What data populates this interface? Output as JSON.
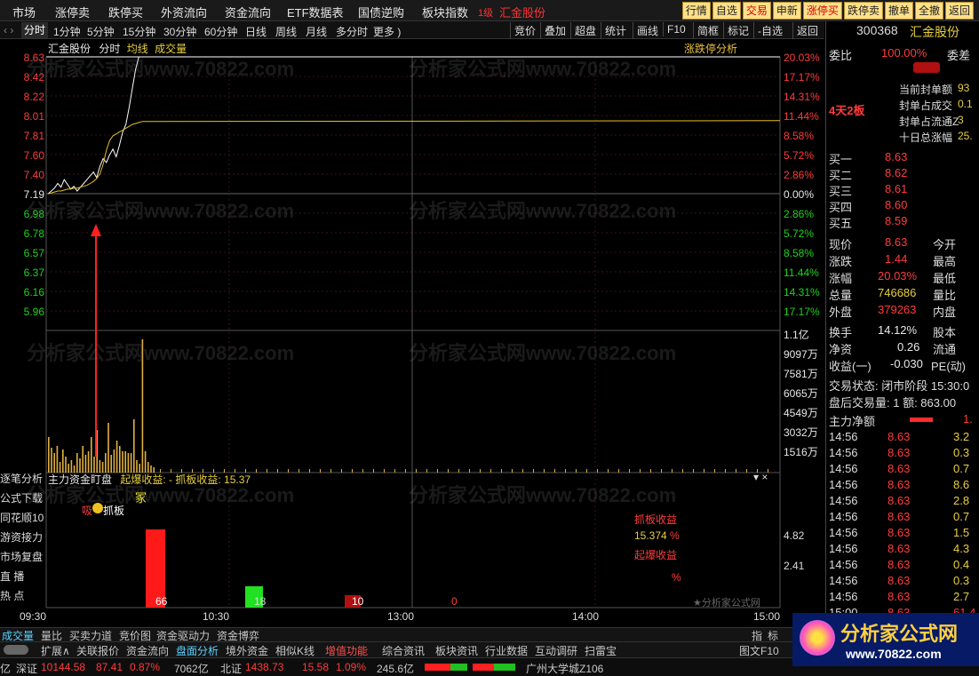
{
  "topbar": {
    "menus": [
      "市场",
      "涨停卖",
      "跌停买",
      "外资流向",
      "资金流向",
      "ETF数据表",
      "国债逆购",
      "板块指数"
    ],
    "stock_badge": "1级",
    "stock_name": "汇金股份",
    "buttons": [
      "行情",
      "自选",
      "交易",
      "申新",
      "涨停买",
      "跌停卖",
      "撤单",
      "全撤",
      "返回"
    ]
  },
  "toolbar": {
    "tabs": [
      "分时",
      "1分钟",
      "5分钟",
      "15分钟",
      "30分钟",
      "60分钟",
      "日线",
      "周线",
      "月线",
      "多分时",
      "更多 )"
    ],
    "right": [
      "竞价",
      "叠加",
      "超盘",
      "统计",
      "画线",
      "简框",
      "标记",
      "-自选",
      "返回"
    ]
  },
  "chart": {
    "title_stock": "汇金股份",
    "title_mode": "分时",
    "title_avg": "均线",
    "title_vol": "成交量",
    "title_right": "涨跌停分析",
    "price_labels": [
      "8.63",
      "8.42",
      "8.22",
      "8.01",
      "7.81",
      "7.60",
      "7.40",
      "7.19",
      "6.98",
      "6.78",
      "6.57",
      "6.37",
      "6.16",
      "5.96"
    ],
    "pct_labels": [
      "20.03%",
      "17.17%",
      "14.31%",
      "11.44%",
      "8.58%",
      "5.72%",
      "2.86%",
      "0.00%",
      "2.86%",
      "5.72%",
      "8.58%",
      "11.44%",
      "14.31%",
      "17.17%"
    ],
    "vol_labels": [
      "1.1亿",
      "9097万",
      "7581万",
      "6065万",
      "4549万",
      "3032万",
      "1516万"
    ]
  },
  "chart_data": {
    "type": "line",
    "x_ticks": [
      "09:30",
      "10:30",
      "13:00",
      "14:00",
      "15:00"
    ],
    "ylim": [
      5.96,
      8.63
    ],
    "series": [],
    "price": [
      7.19,
      7.22,
      7.25,
      7.3,
      7.26,
      7.34,
      7.29,
      7.24,
      7.27,
      7.22,
      7.26,
      7.3,
      7.34,
      7.38,
      7.42,
      7.36,
      7.48,
      7.56,
      7.52,
      7.6,
      7.66,
      7.58,
      7.7,
      7.84,
      7.92,
      8.1,
      8.3,
      8.5,
      8.63,
      8.63
    ],
    "avg": [
      7.19,
      7.2,
      7.21,
      7.22,
      7.22,
      7.23,
      7.24,
      7.24,
      7.25,
      7.25,
      7.26,
      7.27,
      7.28,
      7.3,
      7.32,
      7.35,
      7.4,
      7.5,
      7.65,
      7.75,
      7.8,
      7.82,
      7.84,
      7.86,
      7.88,
      7.9,
      7.92,
      7.93,
      7.94,
      7.95
    ]
  },
  "lower": {
    "title": "主力资金盯盘",
    "sub": "起爆收益: -  抓板收益: 15.37",
    "annot_left": "吸",
    "annot_mid": "抓板",
    "annot_top": "冢",
    "legend1": "抓板收益",
    "legend1_val": "15.374",
    "legend1_unit": "%",
    "legend2": "起爆收益",
    "legend2_unit": "%",
    "axis1": "4.82",
    "axis2": "2.41",
    "bar1_label": "66",
    "bar2_label": "18",
    "bar3_label": "10",
    "bar4_label": "0",
    "watermark": "★分析家公式网"
  },
  "sidenav": [
    "逐笔分析",
    "公式下载",
    "同花顺10",
    "游资接力",
    "市场复盘",
    "直  播",
    "热  点"
  ],
  "rpanel": {
    "code": "300368",
    "name": "汇金股份",
    "webi_label": "委比",
    "webi_val": "100.00%",
    "webi_diff": "委差",
    "days_label": "4天2板",
    "seal_rows": [
      "当前封单额",
      "封单占成交",
      "封单占流通Z",
      "十日总涨幅"
    ],
    "seal_vals": [
      "93",
      "0.1",
      "3",
      "25."
    ],
    "buys": [
      {
        "label": "买一",
        "price": "8.63"
      },
      {
        "label": "买二",
        "price": "8.62"
      },
      {
        "label": "买三",
        "price": "8.61"
      },
      {
        "label": "买四",
        "price": "8.60"
      },
      {
        "label": "买五",
        "price": "8.59"
      }
    ],
    "quote": [
      {
        "label": "现价",
        "val": "8.63",
        "l2": "今开"
      },
      {
        "label": "涨跌",
        "val": "1.44",
        "l2": "最高"
      },
      {
        "label": "涨幅",
        "val": "20.03%",
        "l2": "最低"
      },
      {
        "label": "总量",
        "val": "746686",
        "l2": "量比"
      },
      {
        "label": "外盘",
        "val": "379263",
        "l2": "内盘"
      },
      {
        "label": "换手",
        "val": "14.12%",
        "l2": "股本"
      },
      {
        "label": "净资",
        "val": "0.26",
        "l2": "流通"
      },
      {
        "label": "收益(一)",
        "val": "-0.030",
        "l2": "PE(动)"
      }
    ],
    "trade_state": "交易状态: 闭市阶段 15:30:0",
    "after_trade": "盘后交易量: 1  额: 863.00",
    "flow_label": "主力净额",
    "flow_val": "1.",
    "ticks": [
      {
        "t": "14:56",
        "p": "8.63",
        "v": "3.2"
      },
      {
        "t": "14:56",
        "p": "8.63",
        "v": "0.3"
      },
      {
        "t": "14:56",
        "p": "8.63",
        "v": "0.7"
      },
      {
        "t": "14:56",
        "p": "8.63",
        "v": "8.6"
      },
      {
        "t": "14:56",
        "p": "8.63",
        "v": "2.8"
      },
      {
        "t": "14:56",
        "p": "8.63",
        "v": "0.7"
      },
      {
        "t": "14:56",
        "p": "8.63",
        "v": "1.5"
      },
      {
        "t": "14:56",
        "p": "8.63",
        "v": "4.3"
      },
      {
        "t": "14:56",
        "p": "8.63",
        "v": "0.4"
      },
      {
        "t": "14:56",
        "p": "8.63",
        "v": "0.3"
      },
      {
        "t": "14:56",
        "p": "8.63",
        "v": "2.7"
      },
      {
        "t": "15:00",
        "p": "8.63",
        "v": "61.4"
      }
    ]
  },
  "bottombar": {
    "tabs": [
      "成交量",
      "量比",
      "买卖力道",
      "竞价图",
      "资金驱动力",
      "资金博弈"
    ],
    "right": [
      "指",
      "标"
    ]
  },
  "statusbar": {
    "items": [
      "扩展∧",
      "关联报价",
      "资金流向",
      "盘面分析",
      "境外资金",
      "相似K线",
      "增值功能",
      "综合资讯",
      "板块资讯",
      "行业数据",
      "互动调研",
      "扫雷宝"
    ],
    "right": "图文F10"
  },
  "footer": {
    "prefix": "亿",
    "sz_label": "深证",
    "sz_val": "10144.58",
    "sz_chg": "87.41",
    "sz_pct": "0.87%",
    "sz_amt": "7062亿",
    "bz_label": "北证",
    "bz_val": "1438.73",
    "bz_chg": "15.58",
    "bz_pct": "1.09%",
    "bz_amt": "245.6亿",
    "news": "广州大学城Z106"
  },
  "logo": {
    "title": "分析家公式网",
    "url": "www.70822.com"
  },
  "watermarks": [
    "分析家公式网www.70822.com"
  ]
}
